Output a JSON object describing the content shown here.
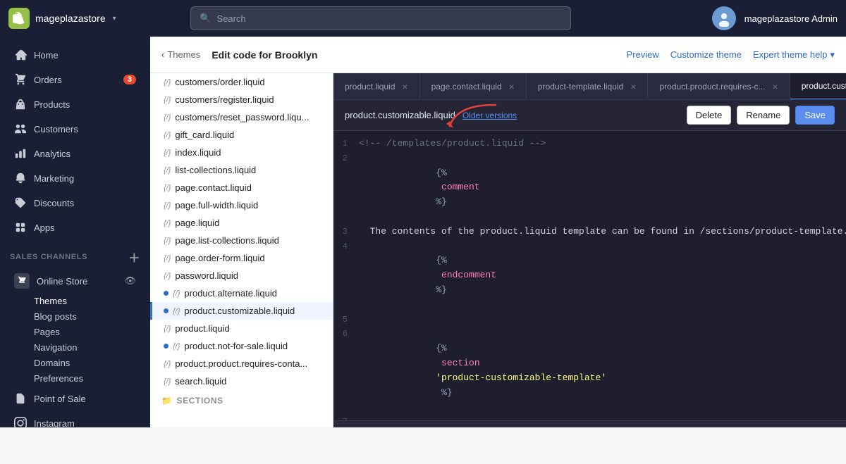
{
  "topnav": {
    "store_name": "mageplazastore",
    "search_placeholder": "Search",
    "admin_name": "mageplazastore Admin"
  },
  "sidebar": {
    "nav_items": [
      {
        "id": "home",
        "label": "Home",
        "icon": "home-icon",
        "badge": null
      },
      {
        "id": "orders",
        "label": "Orders",
        "icon": "orders-icon",
        "badge": "3"
      },
      {
        "id": "products",
        "label": "Products",
        "icon": "products-icon",
        "badge": null
      },
      {
        "id": "customers",
        "label": "Customers",
        "icon": "customers-icon",
        "badge": null
      },
      {
        "id": "analytics",
        "label": "Analytics",
        "icon": "analytics-icon",
        "badge": null
      },
      {
        "id": "marketing",
        "label": "Marketing",
        "icon": "marketing-icon",
        "badge": null
      },
      {
        "id": "discounts",
        "label": "Discounts",
        "icon": "discounts-icon",
        "badge": null
      },
      {
        "id": "apps",
        "label": "Apps",
        "icon": "apps-icon",
        "badge": null
      }
    ],
    "sales_channels_title": "SALES CHANNELS",
    "online_store_label": "Online Store",
    "online_store_sub": [
      {
        "id": "themes",
        "label": "Themes",
        "active": true
      },
      {
        "id": "blog-posts",
        "label": "Blog posts"
      },
      {
        "id": "pages",
        "label": "Pages"
      },
      {
        "id": "navigation",
        "label": "Navigation"
      },
      {
        "id": "domains",
        "label": "Domains"
      },
      {
        "id": "preferences",
        "label": "Preferences"
      }
    ],
    "point_of_sale": "Point of Sale",
    "instagram": "Instagram"
  },
  "breadcrumb": {
    "back_label": "Themes",
    "title_prefix": "Edit code for",
    "title_theme": "Brooklyn",
    "preview": "Preview",
    "customize": "Customize theme",
    "expert_help": "Expert theme help"
  },
  "file_tree": {
    "items": [
      {
        "id": "customers-order",
        "name": "customers/order.liquid",
        "dot": false
      },
      {
        "id": "customers-register",
        "name": "customers/register.liquid",
        "dot": false
      },
      {
        "id": "customers-reset",
        "name": "customers/reset_password.liqu...",
        "dot": false
      },
      {
        "id": "gift-card",
        "name": "gift_card.liquid",
        "dot": false
      },
      {
        "id": "index",
        "name": "index.liquid",
        "dot": false
      },
      {
        "id": "list-collections",
        "name": "list-collections.liquid",
        "dot": false
      },
      {
        "id": "page-contact",
        "name": "page.contact.liquid",
        "dot": false
      },
      {
        "id": "page-full-width",
        "name": "page.full-width.liquid",
        "dot": false
      },
      {
        "id": "page",
        "name": "page.liquid",
        "dot": false
      },
      {
        "id": "page-list-collections",
        "name": "page.list-collections.liquid",
        "dot": false
      },
      {
        "id": "page-order-form",
        "name": "page.order-form.liquid",
        "dot": false
      },
      {
        "id": "password",
        "name": "password.liquid",
        "dot": false
      },
      {
        "id": "product-alternate",
        "name": "product.alternate.liquid",
        "dot": true
      },
      {
        "id": "product-customizable",
        "name": "product.customizable.liquid",
        "dot": true,
        "active": true
      },
      {
        "id": "product-liquid",
        "name": "product.liquid",
        "dot": false
      },
      {
        "id": "product-not-for-sale",
        "name": "product.not-for-sale.liquid",
        "dot": true
      },
      {
        "id": "product-requires",
        "name": "product.product.requires-conta...",
        "dot": false
      },
      {
        "id": "search",
        "name": "search.liquid",
        "dot": false
      }
    ],
    "sections_label": "Sections"
  },
  "tabs": [
    {
      "id": "product-liquid",
      "label": "product.liquid",
      "active": false
    },
    {
      "id": "page-contact-liquid",
      "label": "page.contact.liquid",
      "active": false
    },
    {
      "id": "product-template",
      "label": "product-template.liquid",
      "active": false
    },
    {
      "id": "product-requires",
      "label": "product.product.requires-c...",
      "active": false
    },
    {
      "id": "product-customizable",
      "label": "product.customizable.liquid",
      "active": true
    }
  ],
  "editor": {
    "filename": "product.customizable.liquid",
    "older_versions": "Older versions",
    "delete_btn": "Delete",
    "rename_btn": "Rename",
    "save_btn": "Save",
    "lines": [
      {
        "num": "1",
        "code": "<!-- /templates/product.liquid -->"
      },
      {
        "num": "2",
        "code": "{% comment %}"
      },
      {
        "num": "3",
        "code": "  The contents of the product.liquid template can be found in /sections/product-template.liqu..."
      },
      {
        "num": "4",
        "code": "{% endcomment %}"
      },
      {
        "num": "5",
        "code": ""
      },
      {
        "num": "6",
        "code": "{% section 'product-customizable-template' %}"
      },
      {
        "num": "7",
        "code": ""
      }
    ]
  }
}
